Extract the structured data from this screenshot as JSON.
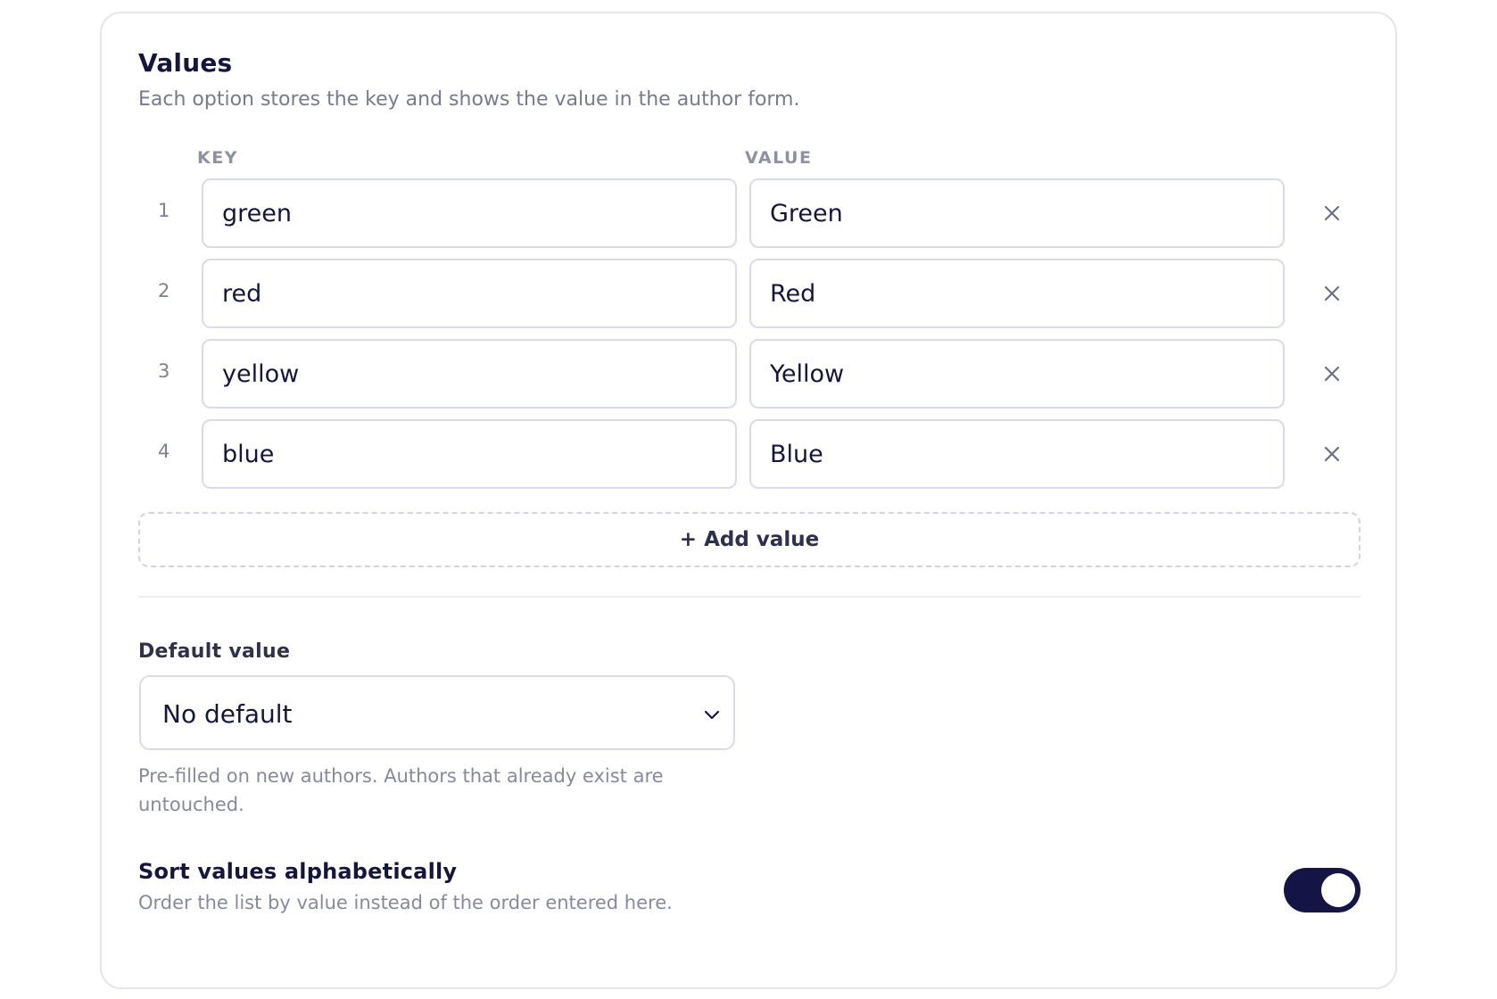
{
  "section": {
    "title": "Values",
    "description": "Each option stores the key and shows the value in the author form."
  },
  "columns": {
    "key": "KEY",
    "value": "VALUE"
  },
  "rows": [
    {
      "index": "1",
      "key": "green",
      "value": "Green"
    },
    {
      "index": "2",
      "key": "red",
      "value": "Red"
    },
    {
      "index": "3",
      "key": "yellow",
      "value": "Yellow"
    },
    {
      "index": "4",
      "key": "blue",
      "value": "Blue"
    }
  ],
  "add_button": {
    "label": "+ Add value"
  },
  "default_value": {
    "label": "Default value",
    "selected": "No default",
    "help": "Pre-filled on new authors. Authors that already exist are untouched."
  },
  "sort": {
    "label": "Sort values alphabetically",
    "help": "Order the list by value instead of the order entered here.",
    "enabled": true
  },
  "icons": {
    "remove": "close-icon",
    "select": "chevron-down-icon"
  },
  "colors": {
    "toggle_on": "#141544",
    "border": "#d9dbe7",
    "muted_text": "#858a9c"
  }
}
